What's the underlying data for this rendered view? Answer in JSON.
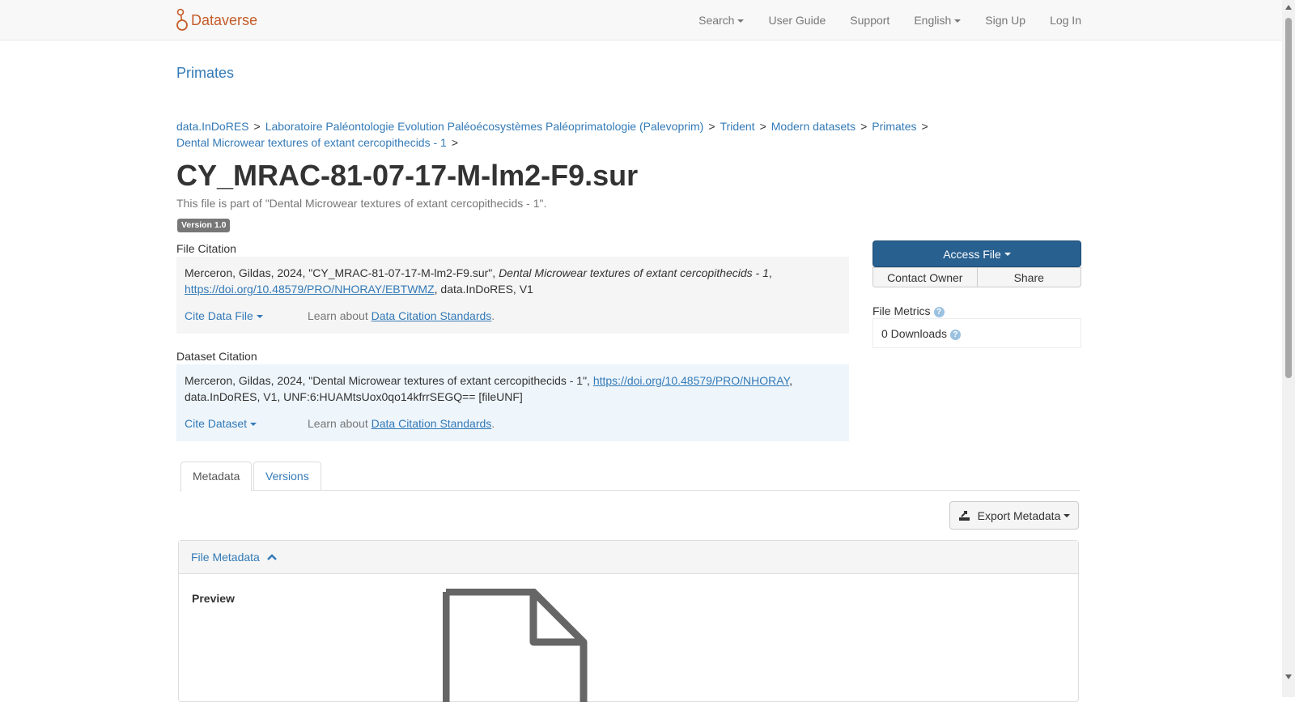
{
  "navbar": {
    "brand": "Dataverse",
    "items": [
      "Search",
      "User Guide",
      "Support",
      "English",
      "Sign Up",
      "Log In"
    ]
  },
  "dataverse_title": "Primates",
  "breadcrumb": [
    "data.InDoRES",
    "Laboratoire Paléontologie Evolution Paléoécosystèmes Paléoprimatologie (Palevoprim)",
    "Trident",
    "Modern datasets",
    "Primates",
    "Dental Microwear textures of extant cercopithecids - 1"
  ],
  "breadcrumb_separator": ">",
  "file": {
    "title": "CY_MRAC-81-07-17-M-lm2-F9.sur",
    "part_of": "This file is part of \"Dental Microwear textures of extant cercopithecids - 1\".",
    "version": "Version 1.0"
  },
  "file_citation": {
    "label": "File Citation",
    "text_prefix": "Merceron, Gildas, 2024, \"CY_MRAC-81-07-17-M-lm2-F9.sur\", ",
    "text_italic": "Dental Microwear textures of extant cercopithecids - 1",
    "text_after_italic": ",",
    "doi": "https://doi.org/10.48579/PRO/NHORAY/EBTWMZ",
    "text_suffix": ", data.InDoRES, V1",
    "cite_button": "Cite Data File",
    "learn_prefix": "Learn about ",
    "learn_link": "Data Citation Standards",
    "learn_suffix": "."
  },
  "dataset_citation": {
    "label": "Dataset Citation",
    "text_prefix": "Merceron, Gildas, 2024, \"Dental Microwear textures of extant cercopithecids - 1\", ",
    "doi": "https://doi.org/10.48579/PRO/NHORAY",
    "text_suffix": ", data.InDoRES, V1, UNF:6:HUAMtsUox0qo14kfrrSEGQ== [fileUNF]",
    "cite_button": "Cite Dataset",
    "learn_prefix": "Learn about ",
    "learn_link": "Data Citation Standards",
    "learn_suffix": "."
  },
  "actions": {
    "access_file": "Access File",
    "contact_owner": "Contact Owner",
    "share": "Share"
  },
  "metrics": {
    "label": "File Metrics",
    "downloads": "0 Downloads"
  },
  "tabs": [
    "Metadata",
    "Versions"
  ],
  "export_button": "Export Metadata",
  "file_metadata": {
    "header": "File Metadata",
    "preview_label": "Preview"
  },
  "colors": {
    "brand": "#c55b28",
    "link": "#337ab7",
    "primary_button": "#286090",
    "file_citation_bg": "#f5f5f5",
    "dataset_citation_bg": "#eef5fb"
  }
}
